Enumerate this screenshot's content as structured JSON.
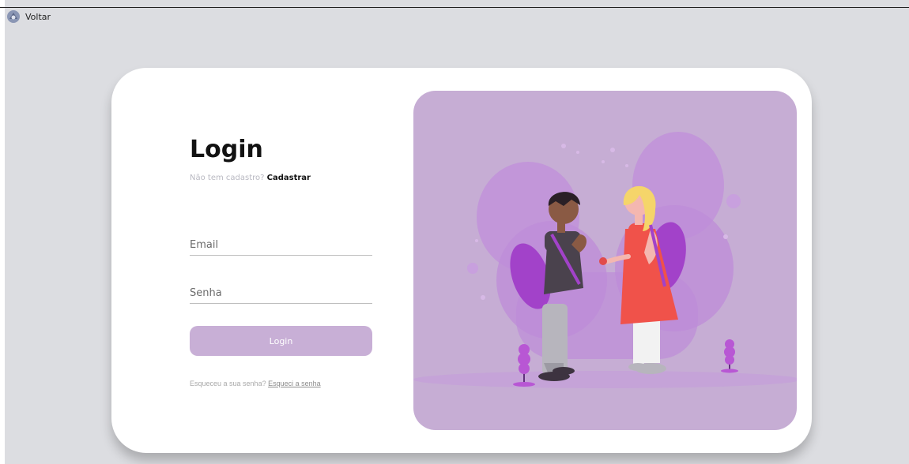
{
  "nav": {
    "back_label": "Voltar"
  },
  "login": {
    "title": "Login",
    "signup_prompt": "Não tem cadastro?",
    "signup_link": "Cadastrar",
    "email_placeholder": "Email",
    "password_placeholder": "Senha",
    "submit_label": "Login",
    "forgot_prompt": "Esqueceu a sua senha?",
    "forgot_link": "Esqueci a senha"
  },
  "colors": {
    "page_background": "#dcdde1",
    "card_background": "#ffffff",
    "accent": "#c8afd6",
    "illustration_background": "#c6add4"
  },
  "icons": {
    "back": "app-logo-icon"
  }
}
